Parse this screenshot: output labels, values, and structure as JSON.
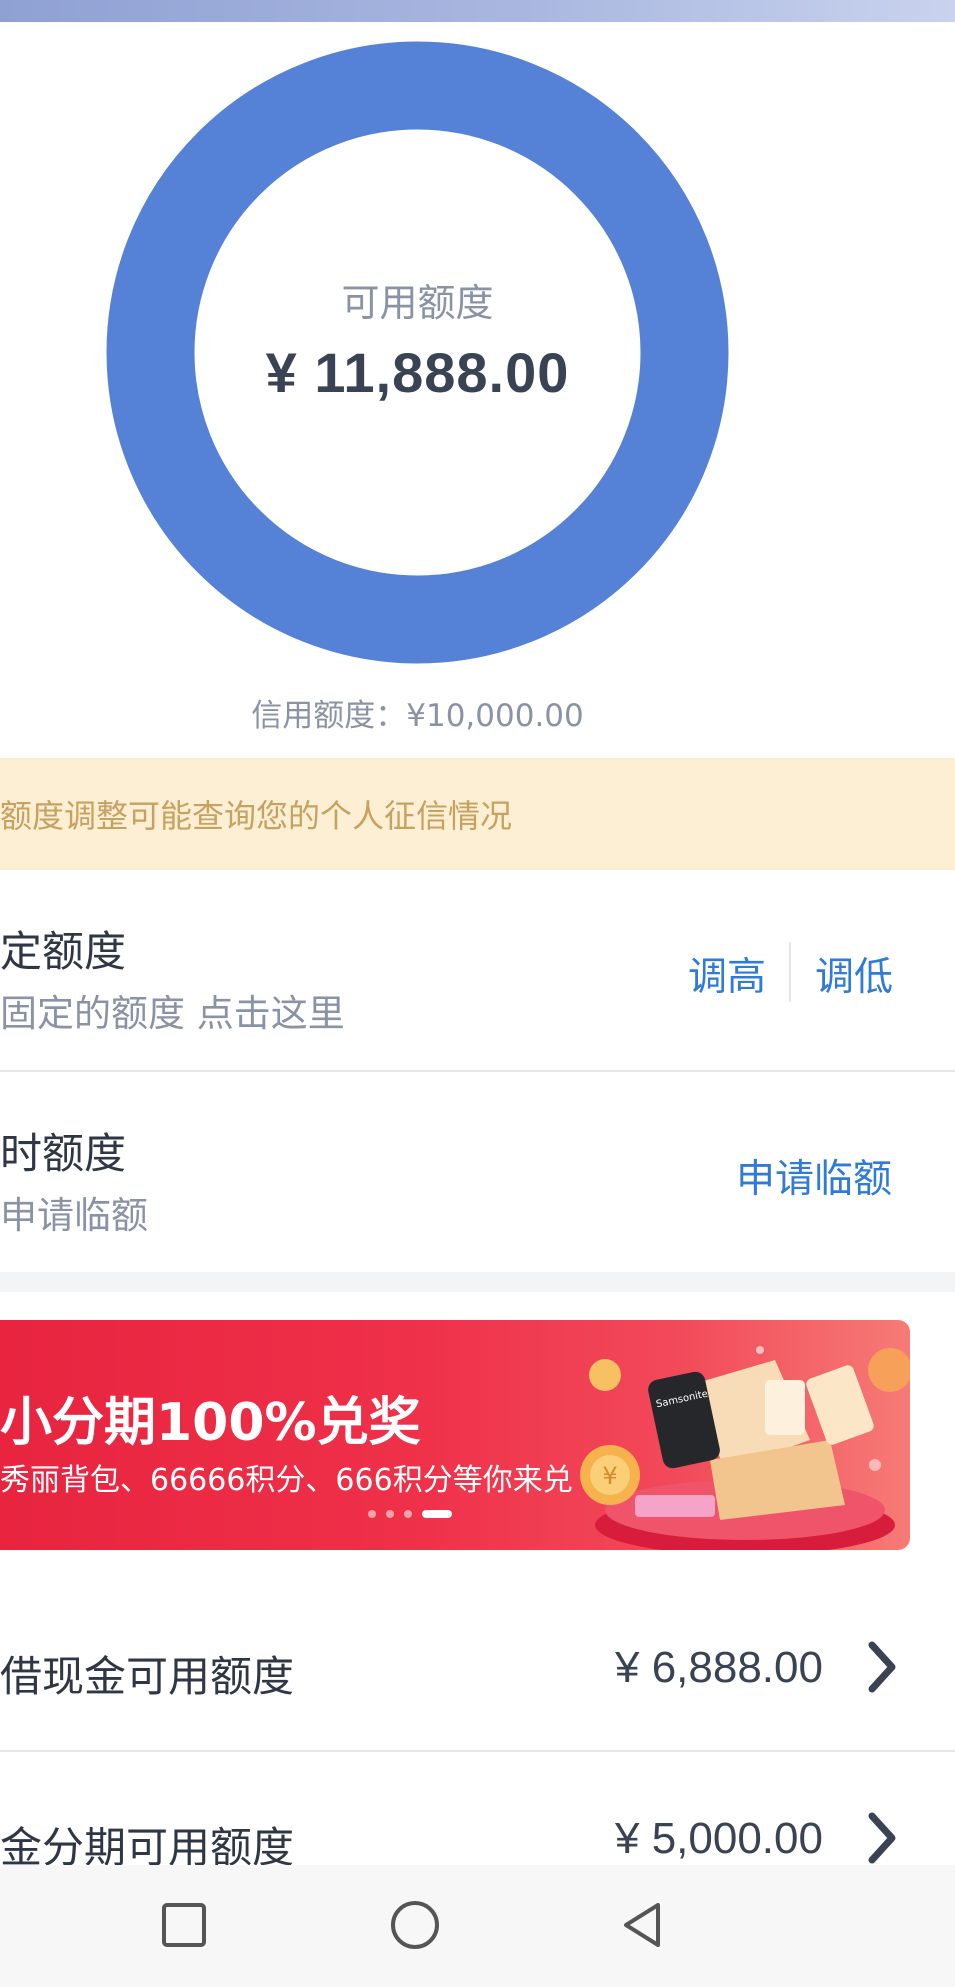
{
  "colors": {
    "donut": "#5582d6",
    "accent_link": "#2f7bd6",
    "notice_bg": "#fcefd3",
    "notice_text": "#c8a160",
    "banner_red": "#ef3049"
  },
  "donut": {
    "label": "可用额度",
    "amount": "¥ 11,888.00",
    "used_fraction": 0.0
  },
  "credit_limit": "信用额度：¥10,000.00",
  "notice": "额度调整可能查询您的个人征信情况",
  "fixed_limit": {
    "title": "定额度",
    "subtitle": "固定的额度 点击这里",
    "raise_label": "调高",
    "lower_label": "调低"
  },
  "temp_limit": {
    "title": "时额度",
    "subtitle": "申请临额",
    "apply_label": "申请临额"
  },
  "banner": {
    "title": "小分期100%兑奖",
    "subtitle": "秀丽背包、66666积分、666积分等你来兑",
    "art_brand": "Samsonite",
    "slide_count": 4,
    "active_slide": 4
  },
  "lines": [
    {
      "label": "借现金可用额度",
      "amount": "¥ 6,888.00",
      "icon": "chevron-right-icon"
    },
    {
      "label": "金分期可用额度",
      "amount": "¥ 5,000.00",
      "icon": "chevron-right-icon"
    }
  ],
  "navbar": {
    "icons": [
      "square-icon",
      "circle-icon",
      "triangle-back-icon"
    ]
  }
}
